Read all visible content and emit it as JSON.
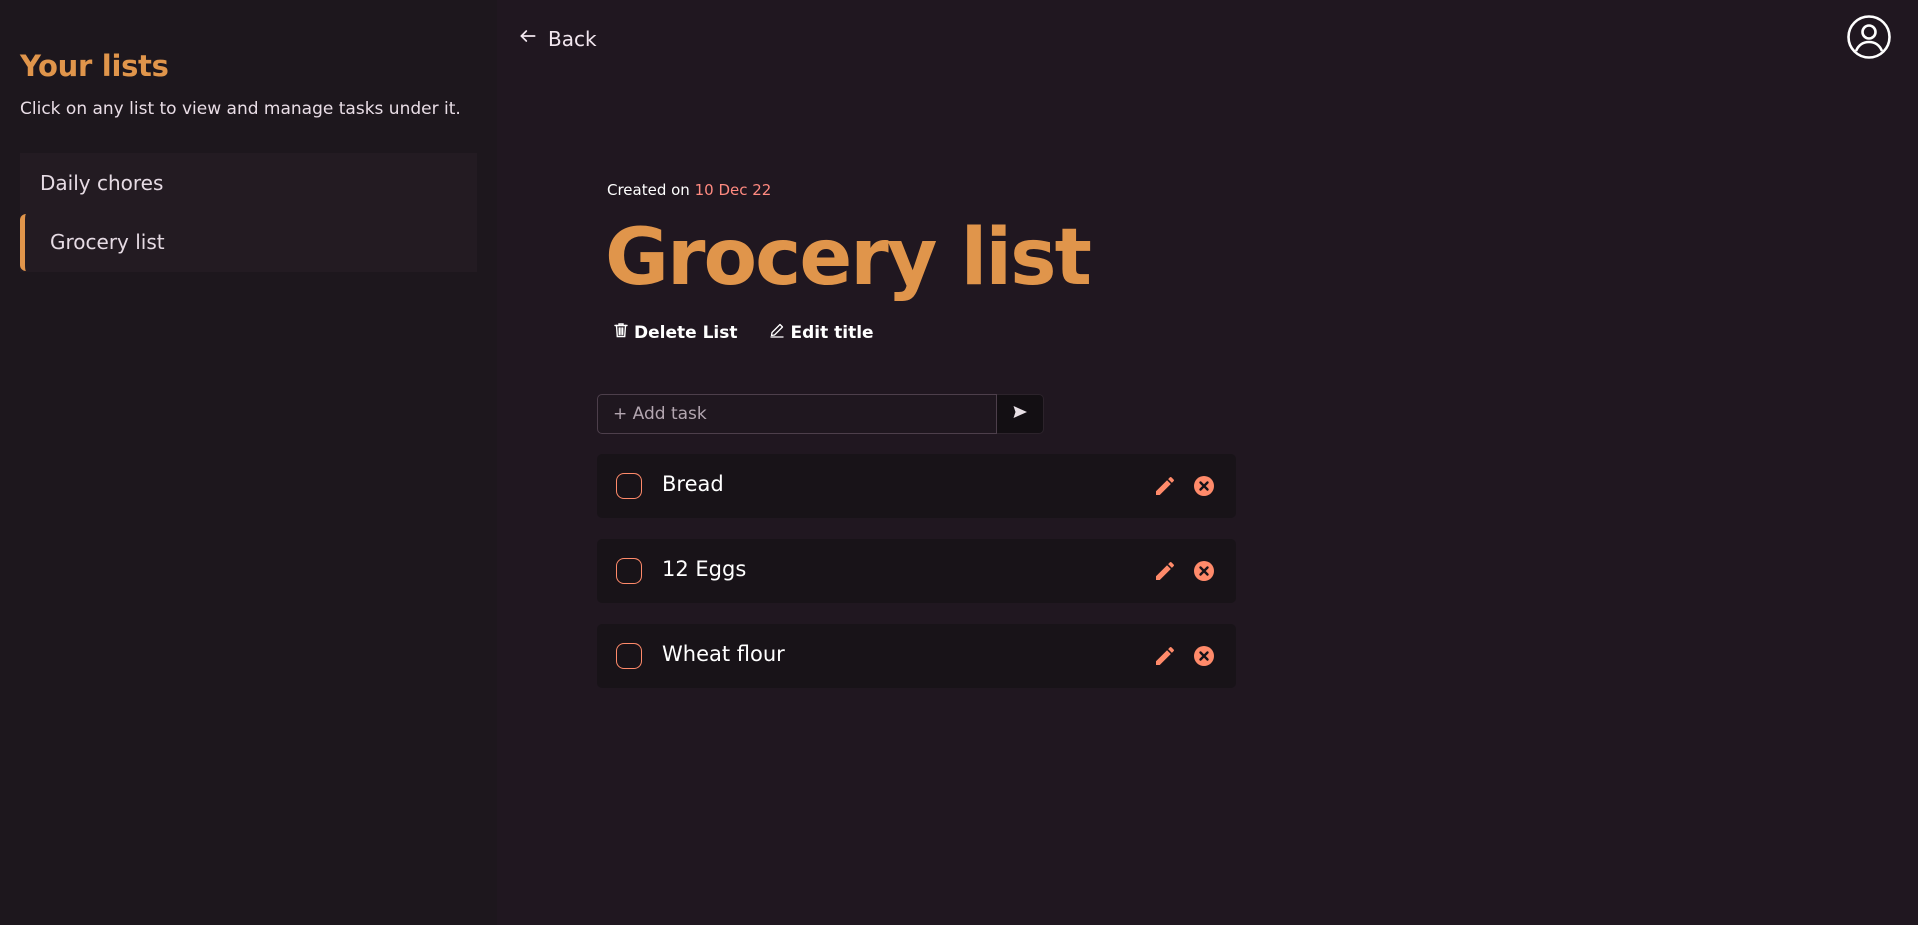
{
  "sidebar": {
    "title": "Your lists",
    "subtitle": "Click on any list to view and manage tasks under it.",
    "lists": [
      {
        "label": "Daily chores",
        "active": false
      },
      {
        "label": "Grocery list",
        "active": true
      }
    ]
  },
  "topbar": {
    "back_label": "Back",
    "back_icon": "arrow-left-icon",
    "user_icon": "user-circle-icon"
  },
  "list": {
    "created_prefix": "Created on",
    "created_date": "10 Dec 22",
    "title": "Grocery list",
    "delete_label": "Delete List",
    "edit_label": "Edit title"
  },
  "add_task": {
    "placeholder": "+ Add task",
    "value": "",
    "send_icon": "send-icon"
  },
  "tasks": [
    {
      "text": "Bread",
      "done": false
    },
    {
      "text": "12 Eggs",
      "done": false
    },
    {
      "text": "Wheat flour",
      "done": false
    }
  ],
  "colors": {
    "accent": "#e0954b",
    "date": "#ff8a80",
    "icon": "#ff8a6a",
    "background": "#201720",
    "sidebar": "#1d171d"
  }
}
